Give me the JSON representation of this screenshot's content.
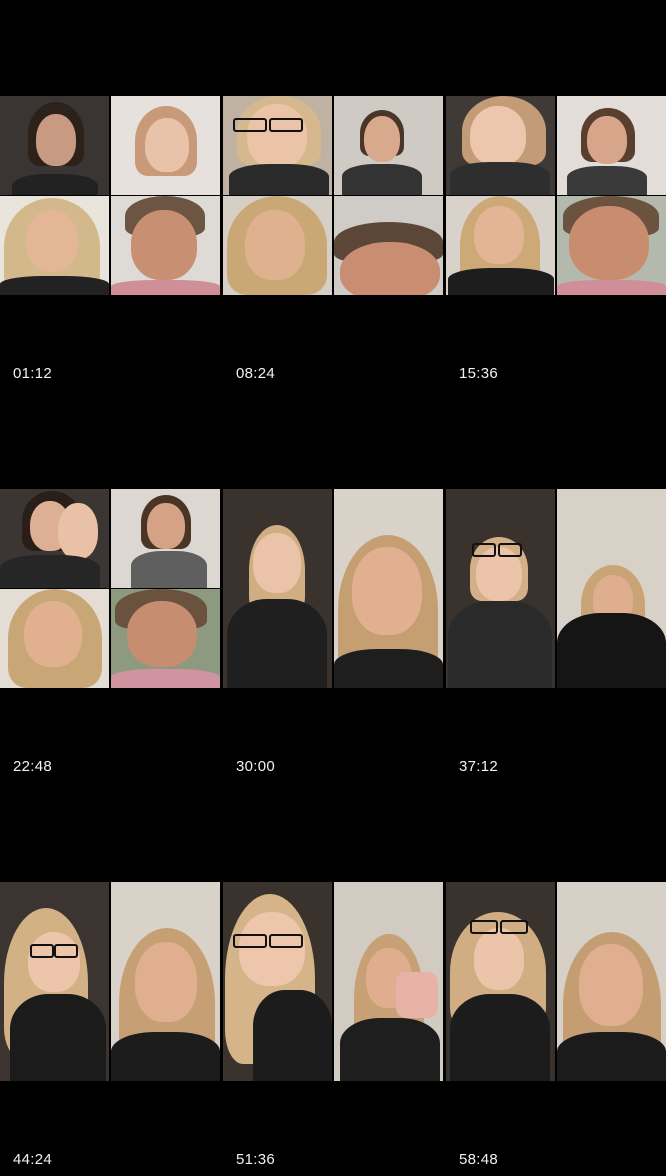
{
  "cells": [
    {
      "time": "01:12",
      "layout": "quad"
    },
    {
      "time": "08:24",
      "layout": "quad"
    },
    {
      "time": "15:36",
      "layout": "quad"
    },
    {
      "time": "22:48",
      "layout": "quad"
    },
    {
      "time": "30:00",
      "layout": "split"
    },
    {
      "time": "37:12",
      "layout": "split"
    },
    {
      "time": "44:24",
      "layout": "split"
    },
    {
      "time": "51:36",
      "layout": "split"
    },
    {
      "time": "58:48",
      "layout": "split"
    }
  ]
}
